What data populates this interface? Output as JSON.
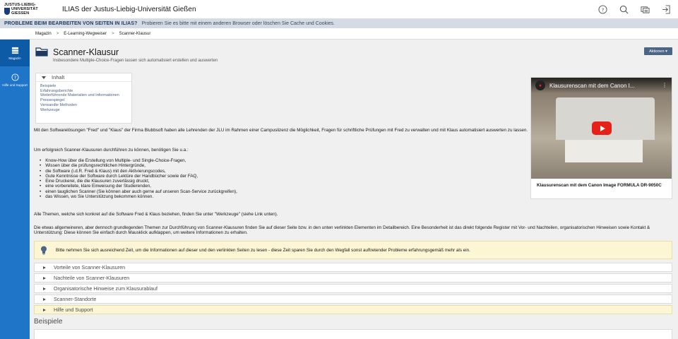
{
  "header": {
    "logo_line1": "JUSTUS-LIEBIG-",
    "logo_line2": "UNIVERSITÄT",
    "logo_line3": "GIESSEN",
    "app_title": "ILIAS der Justus-Liebig-Universität Gießen",
    "icons": [
      "help-icon",
      "search-icon",
      "notifications-icon",
      "logout-icon"
    ]
  },
  "banner": {
    "title": "PROBLEME BEIM BEARBEITEN VON SEITEN IN ILIAS?",
    "message": "Probieren Sie es bitte mit einem anderen Browser oder löschen Sie Cache und Cookies."
  },
  "breadcrumb": [
    "Magazin",
    "E-Learning-Wegweiser",
    "Scanner-Klausur"
  ],
  "sidebar": {
    "items": [
      {
        "label": "Magazin",
        "icon": "repository-icon"
      },
      {
        "label": "Hilfe und Support",
        "icon": "help-support-icon"
      }
    ]
  },
  "page": {
    "title": "Scanner-Klausur",
    "subtitle": "Insbesondere Multiple-Choice-Fragen lassen sich automatisiert erstellen und auswerten",
    "actions_label": "Aktionen ▾"
  },
  "toc": {
    "heading": "Inhalt",
    "items": [
      "Beispiele",
      "Erfahrungsberichte",
      "Weiterführende Materialien und Informationen",
      "Pressespiegel",
      "Verwandte Methoden",
      "Werkzeuge"
    ]
  },
  "video": {
    "title": "Klausurenscan mit dem Canon I...",
    "caption": "Klausurenscan mit dem Canon Image FORMULA DR-9050C"
  },
  "text": {
    "p1": "Mit den Softwarelösungen \"Fred\" und \"Klaus\" der Firma Blubbsoft haben alle Lehrenden der JLU im Rahmen einer Campuslizenz die Möglichkeit, Fragen für schriftliche Prüfungen mit Fred zu verwalten und mit Klaus automatisiert auswerten zu lassen.",
    "p2": "Um erfolgreich Scanner-Klausuren durchführen zu können, benötigen Sie u.a.:",
    "list": [
      "Know-How über die Erstellung von Multiple- und Single-Choice-Fragen,",
      "Wissen über die prüfungsrechtlichen Hintergründe,",
      "die Software (i.d.R. Fred & Klaus) mit den Aktivierungscodes,",
      "Gute Kenntnisse der Software durch Lektüre der Handbücher sowie der FAQ,",
      "Eine Druckerei, die die Klausuren zuverlässig druckt,",
      "eine vorbereitete, klare Einweisung der Studierenden,",
      "einen tauglichen Scanner (Sie können aber auch gerne auf unseren Scan-Service zurückgreifen),",
      "das Wissen, wo Sie Unterstützung bekommen können."
    ],
    "p3": "Alle Themen, welche sich konkret auf die Software Fred & Klaus beziehen, finden Sie unter \"Werkzeuge\" (siehe Link unten).",
    "p4": "Die etwas allgemeineren, aber dennoch grundlegenden Themen zur Durchführung von Scanner-Klausuren finden Sie auf dieser Seite bzw. in den unten verlinkten Elementen im Detailbereich. Eine Besonderheit ist das direkt folgende Register mit Vor- und Nachteilen, organisatorischen Hinweisen sowie Kontakt & Unterstützung: Diese können Sie einfach durch Mausklick aufklappen, um weitere Informationen zu erhalten."
  },
  "note": {
    "text": "Bitte nehmen Sie sich ausreichend Zeit, um die Informationen auf dieser und den verlinkten Seiten zu lesen - diese Zeit sparen Sie durch den Wegfall sonst auftretender Probleme erfahrungsgemäß mehr als ein."
  },
  "accordion": [
    "Vorteile von Scanner-Klausuren",
    "Nachteile von Scanner-Klausuren",
    "Organisatorische Hinweise zum Klausurablauf",
    "Scanner-Standorte",
    "Hilfe und Support"
  ],
  "section": {
    "title": "Beispiele"
  }
}
